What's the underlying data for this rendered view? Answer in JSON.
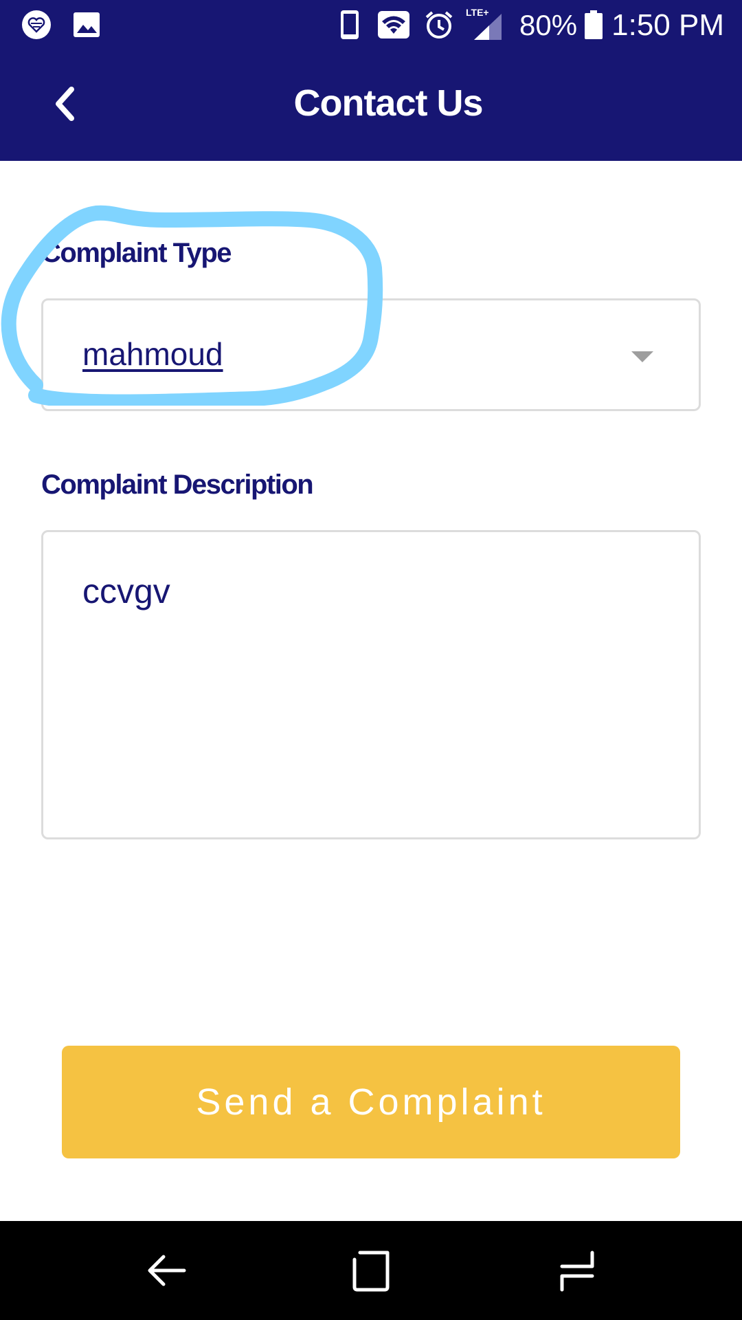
{
  "status_bar": {
    "battery_percent": "80%",
    "time": "1:50 PM",
    "network_label": "LTE+",
    "icons": [
      "app-heart-icon",
      "image-icon",
      "phone-icon",
      "wifi-icon",
      "alarm-icon",
      "signal-icon",
      "battery-icon"
    ]
  },
  "app_bar": {
    "title": "Contact Us",
    "back_icon": "chevron-left-icon"
  },
  "form": {
    "complaint_type_label": "Complaint Type",
    "complaint_type_value": "mahmoud",
    "complaint_description_label": "Complaint Description",
    "complaint_description_value": "ccvgv"
  },
  "send_button_label": "Send a Complaint",
  "nav_bar": {
    "icons": [
      "nav-back-icon",
      "nav-home-icon",
      "nav-recents-icon"
    ]
  },
  "colors": {
    "primary": "#171673",
    "accent": "#f5c242",
    "border": "#dcdcdc",
    "annotation": "#80d4ff"
  }
}
